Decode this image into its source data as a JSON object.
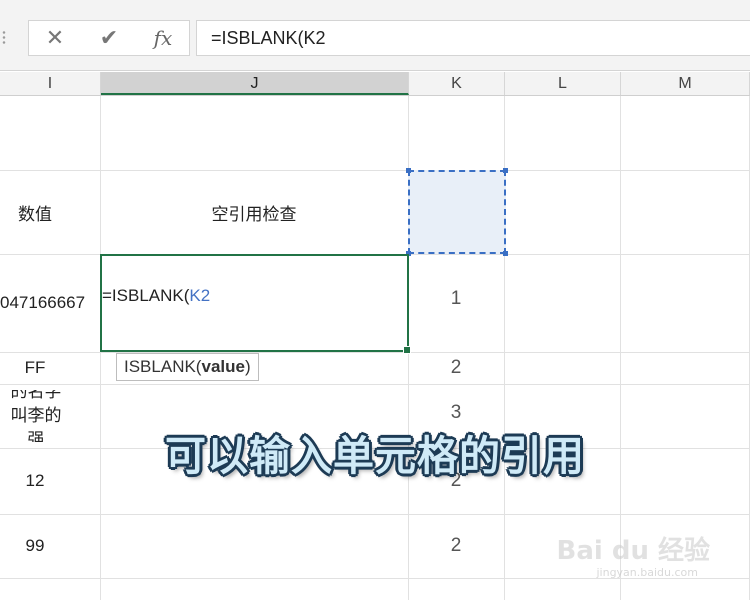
{
  "formula_bar": {
    "cancel_icon": "✕",
    "enter_icon": "✔",
    "fx_label": "fx",
    "formula": "=ISBLANK(K2"
  },
  "columns": [
    "I",
    "J",
    "K",
    "L",
    "M"
  ],
  "rows": {
    "r1": {
      "i": "数值",
      "j": "空引用检查"
    },
    "r2": {
      "i": "047166667",
      "k": "1"
    },
    "r3": {
      "i": "FF",
      "k": "2"
    },
    "r4": {
      "i": "的名字叫李的强",
      "k": "3"
    },
    "r5": {
      "i": "12",
      "k": "2"
    },
    "r6": {
      "i": "99",
      "k": "2"
    }
  },
  "edit": {
    "prefix": "=ISBLANK(",
    "ref": "K2"
  },
  "tooltip": {
    "func": "ISBLANK(",
    "arg": "value",
    "close": ")"
  },
  "caption": "可以输入单元格的引用",
  "watermark": {
    "logo": "Bai du 经验",
    "url": "jingyan.baidu.com"
  },
  "colors": {
    "active_border": "#217346",
    "ref_border": "#3a6fc4",
    "ref_text": "#4472c4"
  }
}
